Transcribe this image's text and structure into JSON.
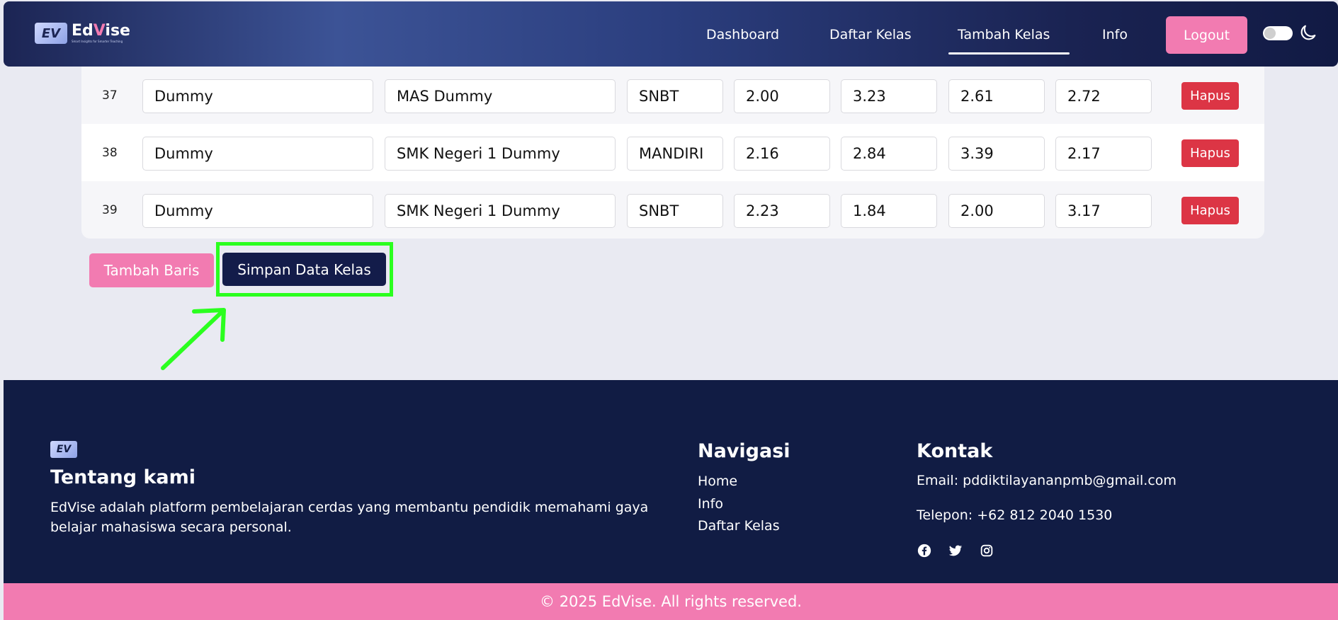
{
  "brand": {
    "name_prefix": "Ed",
    "name_v": "V",
    "name_suffix": "ise",
    "mark": "EV",
    "tagline": "Smart Insights for Smarter Teaching"
  },
  "nav": {
    "items": [
      {
        "label": "Dashboard"
      },
      {
        "label": "Daftar Kelas"
      },
      {
        "label": "Tambah Kelas",
        "active": true
      },
      {
        "label": "Info"
      }
    ],
    "logout_label": "Logout"
  },
  "table": {
    "rows": [
      {
        "no": "37",
        "nama": "Dummy",
        "sekolah": "MAS Dummy",
        "jalur": "SNBT",
        "v1": "2.00",
        "v2": "3.23",
        "v3": "2.61",
        "v4": "2.72"
      },
      {
        "no": "38",
        "nama": "Dummy",
        "sekolah": "SMK Negeri 1 Dummy",
        "jalur": "MANDIRI",
        "v1": "2.16",
        "v2": "2.84",
        "v3": "3.39",
        "v4": "2.17"
      },
      {
        "no": "39",
        "nama": "Dummy",
        "sekolah": "SMK Negeri 1 Dummy",
        "jalur": "SNBT",
        "v1": "2.23",
        "v2": "1.84",
        "v3": "2.00",
        "v4": "3.17"
      }
    ],
    "delete_label": "Hapus"
  },
  "actions": {
    "add_row_label": "Tambah Baris",
    "save_label": "Simpan Data Kelas"
  },
  "footer": {
    "about_title": "Tentang kami",
    "about_text": "EdVise adalah platform pembelajaran cerdas yang membantu pendidik memahami gaya belajar mahasiswa secara personal.",
    "nav_title": "Navigasi",
    "nav_links": [
      "Home",
      "Info",
      "Daftar Kelas"
    ],
    "contact_title": "Kontak",
    "email": "Email: pddiktilayananpmb@gmail.com",
    "phone": "Telepon: +62 812 2040 1530",
    "copyright": "© 2025 EdVise. All rights reserved."
  },
  "colors": {
    "navy": "#111c44",
    "pink": "#f27bb1",
    "danger": "#dc3545",
    "highlight": "#2bff1f"
  },
  "icons": [
    "moon-icon",
    "facebook-icon",
    "twitter-icon",
    "instagram-icon"
  ]
}
